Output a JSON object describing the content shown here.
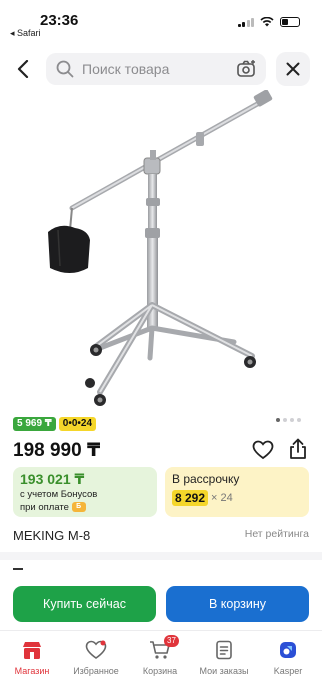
{
  "status_bar": {
    "time": "23:36",
    "back_app": "◂ Safari",
    "battery_icon": "battery-icon",
    "wifi_icon": "wifi-icon",
    "signal_icon": "signal-icon"
  },
  "search": {
    "placeholder": "Поиск товара",
    "icon": "search-icon",
    "camera_icon": "camera-icon"
  },
  "product": {
    "badge_price": "5 969 ₸",
    "badge_installment": "0•0•24",
    "price": "198 990 ₸",
    "bonus_price": "193 021 ₸",
    "bonus_line1": "с учетом Бонусов",
    "bonus_line2": "при оплате",
    "installment_title": "В рассрочку",
    "installment_amount": "8 292",
    "installment_times": "× 24",
    "name": "MEKING M-8",
    "rating": "Нет рейтинга",
    "section_dash": "–"
  },
  "gallery": {
    "total": 4,
    "active": 0
  },
  "actions": {
    "buy_now": "Купить сейчас",
    "add_to_cart": "В корзину"
  },
  "tabbar": {
    "items": [
      {
        "label": "Магазин",
        "icon": "shop-icon",
        "active": true
      },
      {
        "label": "Избранное",
        "icon": "heart-icon"
      },
      {
        "label": "Корзина",
        "icon": "cart-icon",
        "badge": "37"
      },
      {
        "label": "Мои заказы",
        "icon": "orders-icon"
      },
      {
        "label": "Kasper",
        "icon": "kasper-icon"
      }
    ]
  },
  "colors": {
    "green": "#1ea248",
    "blue": "#1a6fd0",
    "red": "#e0343b",
    "yellow": "#f5d62a"
  }
}
